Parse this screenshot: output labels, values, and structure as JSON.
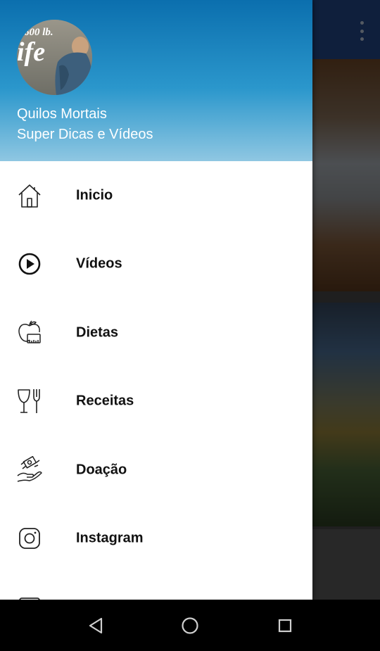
{
  "drawer": {
    "header": {
      "avatar_text": "600 lb. ife",
      "title": "Quilos Mortais",
      "subtitle": "Super Dicas e Vídeos"
    },
    "items": [
      {
        "label": "Inicio",
        "icon": "home-icon"
      },
      {
        "label": "Vídeos",
        "icon": "play-circle-icon"
      },
      {
        "label": "Dietas",
        "icon": "apple-scale-icon"
      },
      {
        "label": "Receitas",
        "icon": "glass-fork-icon"
      },
      {
        "label": "Doação",
        "icon": "donate-hand-icon"
      },
      {
        "label": "Instagram",
        "icon": "instagram-icon"
      },
      {
        "label": "",
        "icon": "partial-item-icon"
      }
    ]
  },
  "background": {
    "toolbar_color": "#1c3a6e",
    "overflow_icon": "overflow-menu-icon"
  },
  "navbar": {
    "back_icon": "back-triangle-icon",
    "home_icon": "home-circle-icon",
    "recents_icon": "recents-square-icon"
  }
}
